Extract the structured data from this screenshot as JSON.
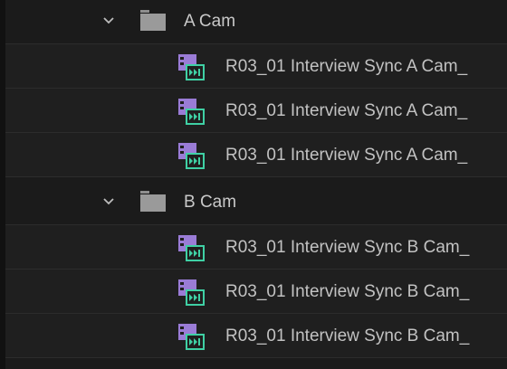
{
  "bins": [
    {
      "name": "A Cam",
      "icon": "folder-icon",
      "expanded": true,
      "clips": [
        {
          "name": "R03_01 Interview Sync A Cam_",
          "icon": "multicam-clip-icon"
        },
        {
          "name": "R03_01 Interview Sync A Cam_",
          "icon": "multicam-clip-icon"
        },
        {
          "name": "R03_01 Interview Sync A Cam_",
          "icon": "multicam-clip-icon"
        }
      ]
    },
    {
      "name": "B Cam",
      "icon": "folder-icon",
      "expanded": true,
      "clips": [
        {
          "name": "R03_01 Interview Sync B Cam_",
          "icon": "multicam-clip-icon"
        },
        {
          "name": "R03_01 Interview Sync B Cam_",
          "icon": "multicam-clip-icon"
        },
        {
          "name": "R03_01 Interview Sync B Cam_",
          "icon": "multicam-clip-icon"
        }
      ]
    }
  ],
  "colors": {
    "background": "#1b1b1b",
    "row_divider": "#2c2c2c",
    "text": "#c9c9c9",
    "folder": "#9a9a9a",
    "clip_purple": "#9a7cd6",
    "clip_green": "#3fd0a4"
  }
}
